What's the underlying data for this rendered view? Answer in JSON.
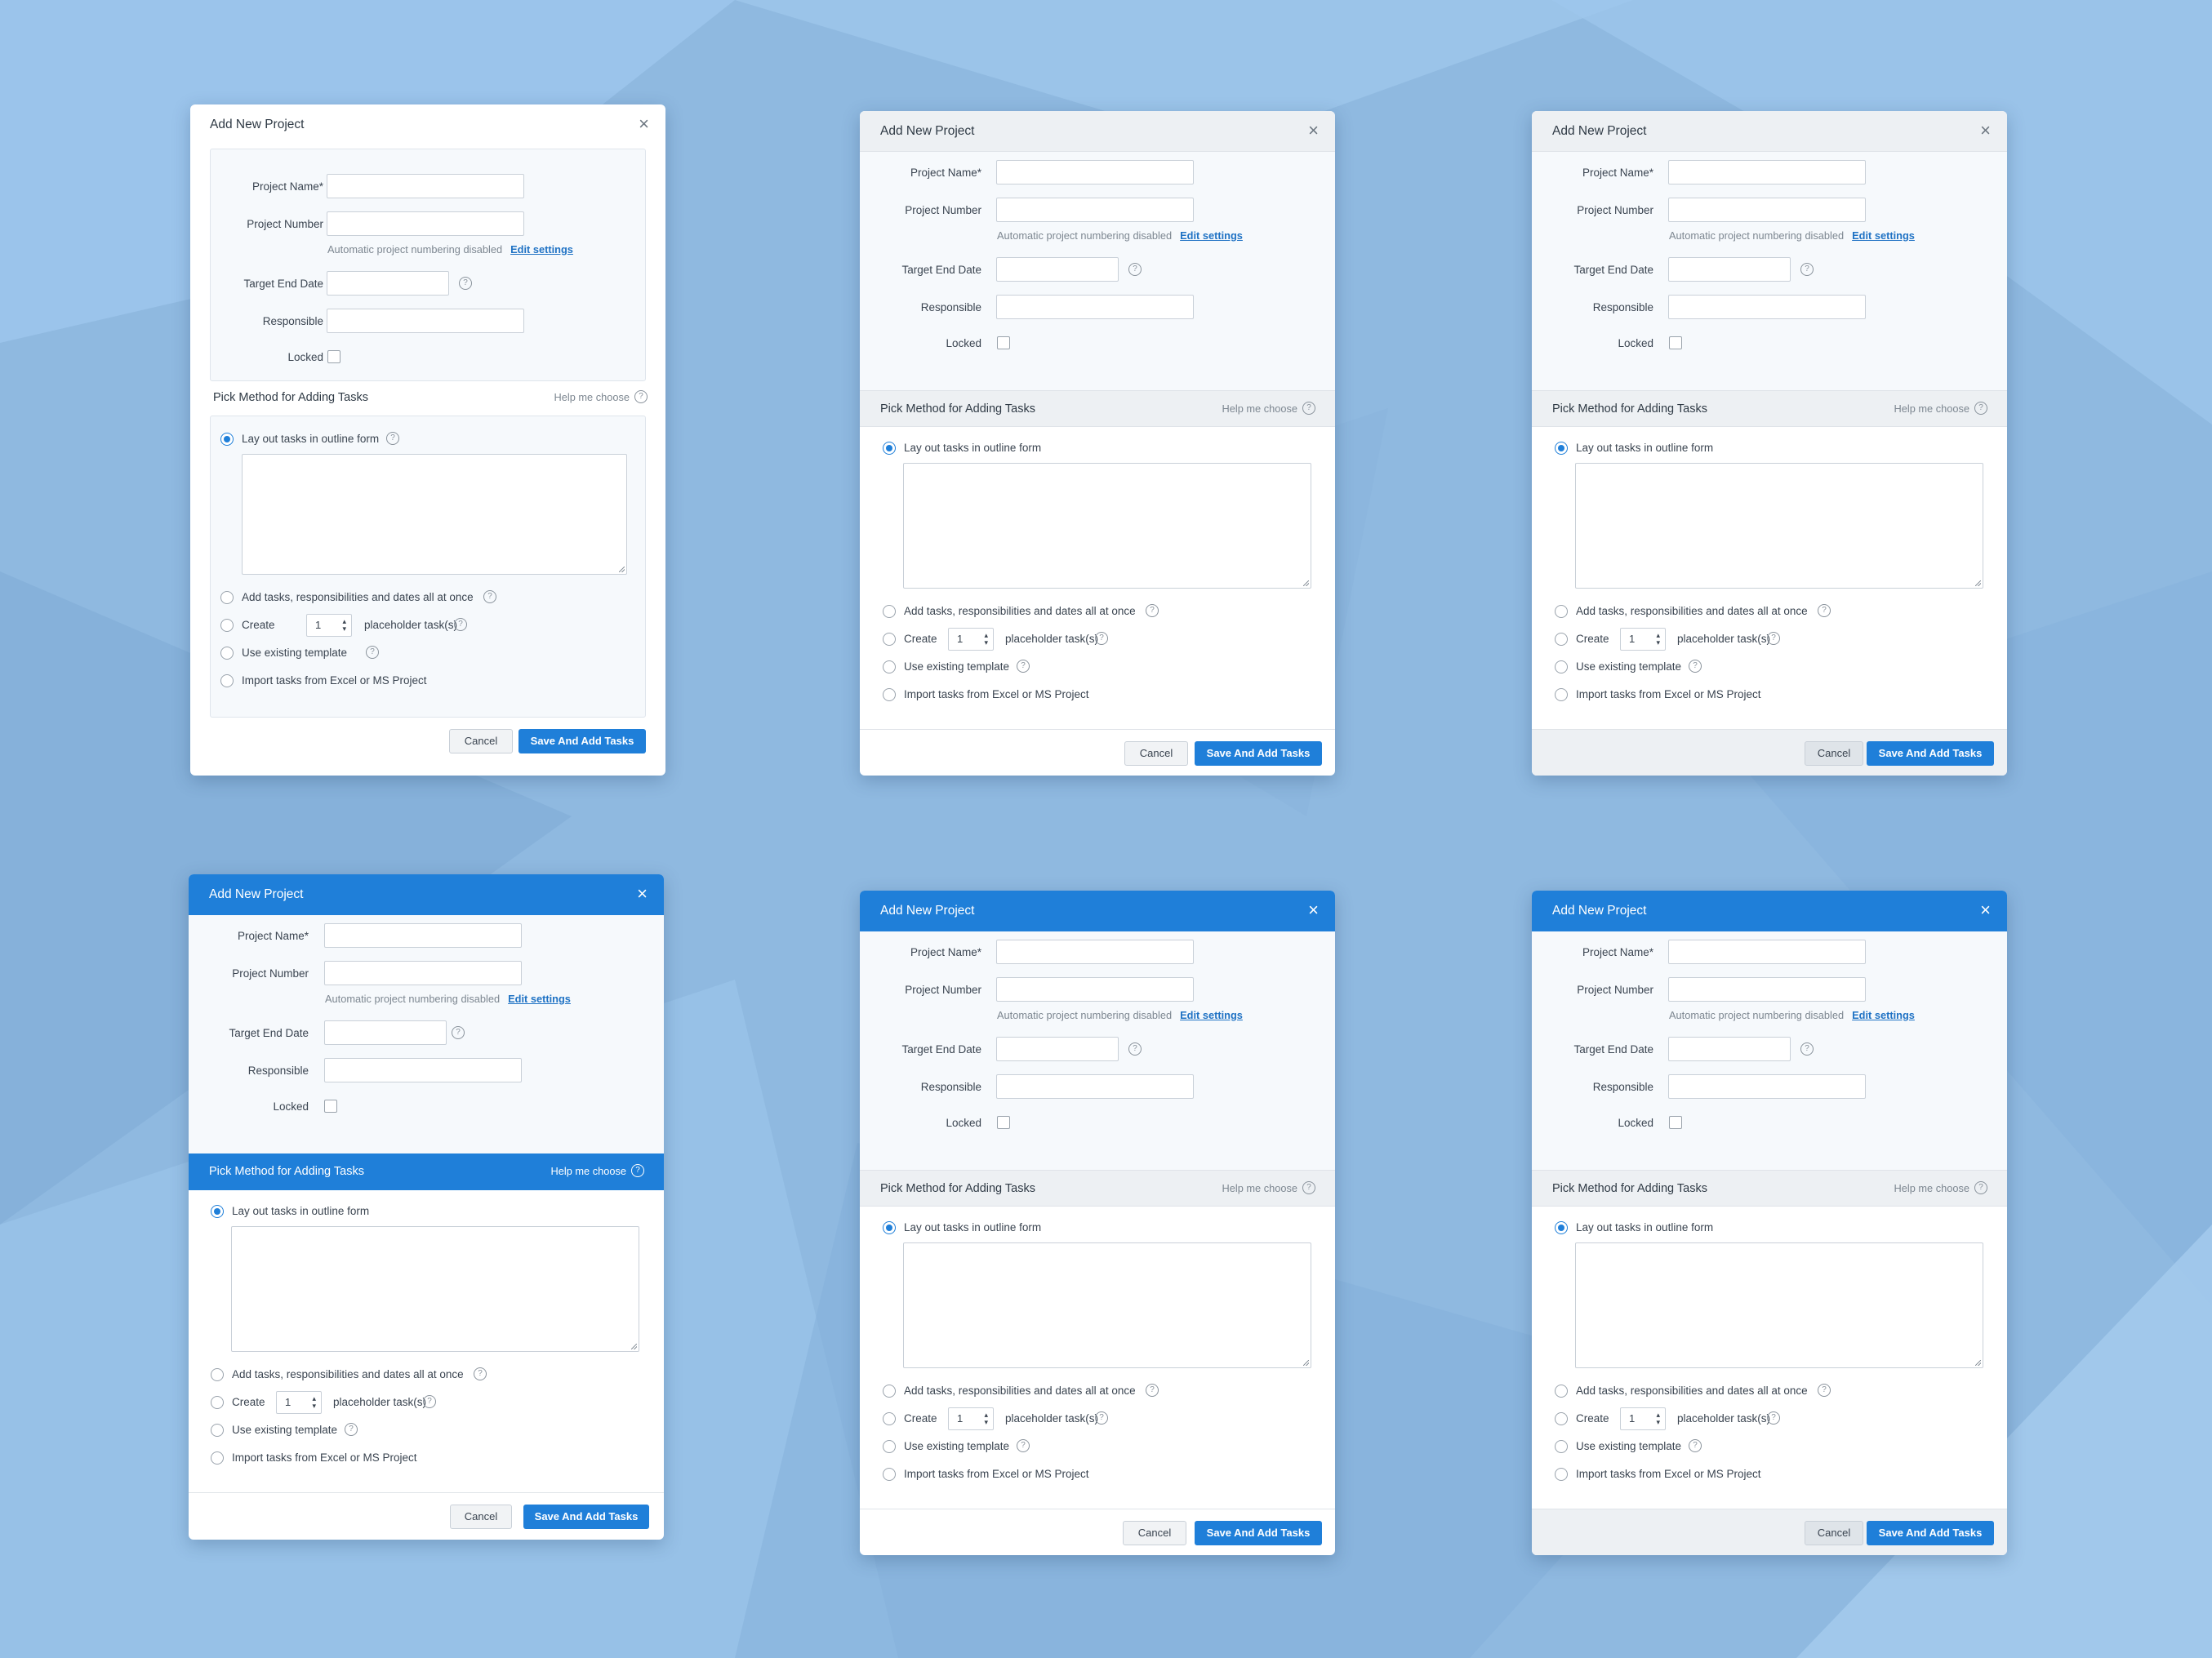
{
  "colors": {
    "accent": "#1f7fd9",
    "background": "#8fb9e0",
    "panel_gray": "#edf0f3"
  },
  "dialog": {
    "title": "Add New Project",
    "close_icon": "close-icon",
    "fields": {
      "project_name": "Project Name*",
      "project_number": "Project Number",
      "numbering_hint": "Automatic project numbering disabled",
      "edit_settings": "Edit settings",
      "target_end_date": "Target End Date",
      "responsible": "Responsible",
      "locked": "Locked"
    },
    "section": {
      "title": "Pick Method for Adding Tasks",
      "help": "Help me choose"
    },
    "options": {
      "outline": "Lay out tasks in outline form",
      "all_at_once": "Add tasks, responsibilities and dates all at once",
      "create": "Create",
      "placeholder_count": "1",
      "placeholder": "placeholder task(s)",
      "template": "Use existing template",
      "import": "Import tasks from Excel or MS Project"
    },
    "buttons": {
      "cancel": "Cancel",
      "save": "Save And Add Tasks"
    }
  }
}
